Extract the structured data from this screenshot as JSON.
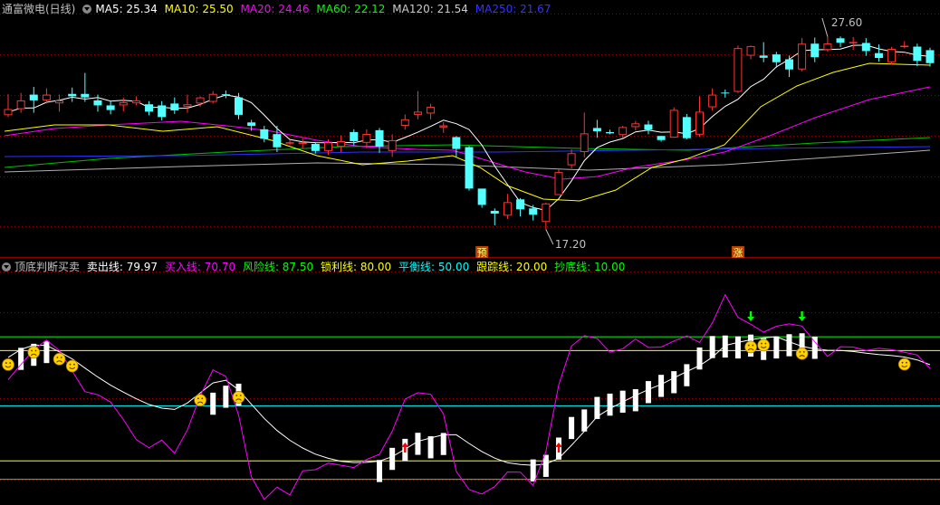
{
  "header": {
    "title": "通富微电(日线)",
    "ma": [
      {
        "label": "MA5: 25.34",
        "color": "#ffffff"
      },
      {
        "label": "MA10: 25.50",
        "color": "#ffff00"
      },
      {
        "label": "MA20: 24.46",
        "color": "#ff00ff"
      },
      {
        "label": "MA60: 22.12",
        "color": "#00ff00"
      },
      {
        "label": "MA120: 21.54",
        "color": "#cccccc"
      },
      {
        "label": "MA250: 21.67",
        "color": "#3333ff"
      }
    ]
  },
  "indicator_header": {
    "name": "顶底判断买卖",
    "lines": [
      {
        "label": "卖出线: 79.97",
        "color": "#ffffff"
      },
      {
        "label": "买入线: 70.70",
        "color": "#ff00ff"
      },
      {
        "label": "风险线: 87.50",
        "color": "#00ff00"
      },
      {
        "label": "锁利线: 80.00",
        "color": "#ffff00"
      },
      {
        "label": "平衡线: 50.00",
        "color": "#00ffff"
      },
      {
        "label": "跟踪线: 20.00",
        "color": "#ffff00"
      },
      {
        "label": "抄底线: 10.00",
        "color": "#00ff00"
      }
    ]
  },
  "colors": {
    "up": "#ff3333",
    "down": "#54ffff",
    "grid": "#880000",
    "text": "#c0c0c0"
  },
  "chart_data": [
    {
      "type": "candlestick",
      "ylim": [
        16.0,
        28.6
      ],
      "high_label": "27.60",
      "low_label": "17.20",
      "markers": [
        {
          "index": 37,
          "text": "预"
        },
        {
          "index": 57,
          "text": "涨"
        }
      ],
      "candles": [
        [
          23.36,
          23.69,
          23.26,
          24.49
        ],
        [
          23.69,
          24.16,
          23.49,
          24.56
        ],
        [
          24.47,
          24.16,
          23.49,
          24.89
        ],
        [
          24.16,
          24.47,
          23.99,
          24.81
        ],
        [
          24.0,
          24.16,
          23.55,
          24.47
        ],
        [
          24.51,
          24.38,
          24.08,
          24.85
        ],
        [
          24.51,
          24.32,
          24.08,
          25.64
        ],
        [
          24.16,
          23.89,
          23.55,
          24.47
        ],
        [
          23.89,
          23.64,
          23.41,
          24.12
        ],
        [
          23.89,
          24.06,
          23.57,
          24.31
        ],
        [
          24.0,
          24.16,
          23.89,
          24.38
        ],
        [
          23.95,
          23.55,
          23.36,
          24.12
        ],
        [
          23.89,
          23.26,
          23.08,
          24.12
        ],
        [
          23.99,
          23.62,
          23.43,
          24.32
        ],
        [
          23.81,
          23.95,
          23.49,
          24.47
        ],
        [
          23.99,
          24.32,
          23.81,
          24.38
        ],
        [
          24.08,
          24.51,
          23.99,
          24.66
        ],
        [
          24.49,
          24.47,
          24.28,
          24.69
        ],
        [
          24.32,
          23.38,
          23.14,
          24.56
        ],
        [
          22.97,
          22.79,
          22.52,
          23.11
        ],
        [
          22.6,
          22.09,
          21.9,
          22.79
        ],
        [
          22.34,
          21.63,
          21.37,
          22.79
        ],
        [
          21.86,
          21.9,
          21.74,
          22.03
        ],
        [
          21.85,
          21.89,
          21.54,
          22.12
        ],
        [
          21.81,
          21.43,
          21.29,
          21.9
        ],
        [
          21.43,
          21.89,
          21.22,
          22.06
        ],
        [
          21.66,
          21.96,
          21.37,
          22.28
        ],
        [
          22.45,
          21.96,
          21.73,
          22.6
        ],
        [
          21.87,
          22.35,
          21.59,
          22.6
        ],
        [
          22.55,
          21.66,
          21.33,
          22.67
        ],
        [
          21.43,
          22.01,
          21.11,
          22.33
        ],
        [
          22.79,
          23.14,
          22.58,
          23.4
        ],
        [
          23.38,
          23.55,
          23.14,
          24.66
        ],
        [
          23.45,
          23.81,
          23.14,
          23.98
        ],
        [
          22.7,
          22.81,
          22.41,
          22.99
        ],
        [
          22.18,
          21.54,
          21.07,
          22.23
        ],
        [
          21.64,
          19.4,
          19.29,
          21.7
        ],
        [
          19.4,
          18.52,
          18.37,
          18.58
        ],
        [
          18.2,
          18.05,
          17.42,
          18.33
        ],
        [
          17.94,
          18.67,
          17.76,
          19.11
        ],
        [
          18.82,
          18.28,
          17.9,
          18.89
        ],
        [
          18.33,
          17.99,
          17.68,
          18.52
        ],
        [
          17.6,
          18.6,
          17.2,
          18.65
        ],
        [
          19.05,
          20.29,
          19.05,
          20.42
        ],
        [
          20.66,
          21.31,
          20.49,
          21.52
        ],
        [
          21.37,
          22.38,
          21.09,
          23.5
        ],
        [
          22.67,
          22.49,
          22.14,
          23.11
        ],
        [
          22.45,
          22.38,
          22.33,
          22.58
        ],
        [
          22.29,
          22.72,
          22.14,
          22.79
        ],
        [
          22.72,
          22.92,
          22.54,
          23.05
        ],
        [
          22.86,
          22.58,
          22.33,
          23.06
        ],
        [
          22.24,
          22.02,
          21.93,
          22.24
        ],
        [
          22.15,
          23.65,
          22.14,
          23.78
        ],
        [
          23.26,
          22.12,
          22.06,
          23.42
        ],
        [
          22.31,
          23.55,
          22.2,
          24.38
        ],
        [
          23.79,
          24.47,
          23.6,
          24.81
        ],
        [
          24.58,
          24.56,
          24.31,
          24.75
        ],
        [
          24.62,
          26.98,
          24.56,
          27.12
        ],
        [
          26.57,
          27.09,
          26.38,
          27.12
        ],
        [
          26.58,
          26.46,
          26.22,
          27.3
        ],
        [
          26.64,
          26.22,
          25.92,
          26.78
        ],
        [
          26.38,
          25.83,
          25.42,
          26.58
        ],
        [
          25.83,
          27.22,
          25.73,
          27.52
        ],
        [
          27.22,
          26.49,
          26.22,
          27.55
        ],
        [
          26.88,
          27.23,
          26.78,
          27.6
        ],
        [
          27.51,
          27.27,
          27.04,
          27.61
        ],
        [
          27.26,
          27.31,
          26.89,
          27.58
        ],
        [
          27.26,
          26.82,
          26.56,
          27.52
        ],
        [
          26.71,
          26.45,
          26.25,
          27.18
        ],
        [
          26.22,
          26.94,
          26.1,
          27.05
        ],
        [
          27.05,
          27.11,
          26.97,
          27.35
        ],
        [
          27.06,
          26.29,
          26.01,
          27.22
        ],
        [
          26.87,
          26.17,
          25.99,
          27.0
        ]
      ],
      "ma5": [
        23.53,
        23.74,
        23.75,
        24.06,
        24.17,
        24.33,
        24.23,
        24.31,
        24.12,
        24.16,
        24.11,
        23.78,
        23.79,
        23.73,
        23.74,
        23.94,
        24.23,
        24.45,
        24.34,
        24.04,
        23.37,
        22.64,
        22.05,
        21.92,
        21.88,
        21.87,
        21.9,
        21.87,
        22.02,
        22.04,
        21.89,
        22.16,
        22.44,
        22.76,
        23.09,
        22.9,
        22.59,
        21.75,
        20.61,
        19.62,
        18.65,
        18.38,
        18.22,
        18.85,
        19.82,
        20.91,
        21.61,
        21.91,
        22.1,
        22.46,
        22.56,
        22.44,
        22.46,
        22.36,
        22.64,
        23.29,
        23.84,
        24.22,
        24.91,
        25.3,
        25.97,
        26.38,
        26.84,
        26.89,
        26.9,
        26.93,
        27.13,
        27.14,
        26.94,
        26.8,
        26.76,
        26.6,
        26.53
      ]
    },
    {
      "type": "line",
      "ylim": [
        -3,
        123
      ],
      "reference_lines": [
        {
          "name": "风险线",
          "value": 87.5,
          "color": "#00ff00"
        },
        {
          "name": "锁利线",
          "value": 80.0,
          "color": "#ffff00"
        },
        {
          "name": "平衡线",
          "value": 50.0,
          "color": "#00ffff"
        },
        {
          "name": "跟踪线",
          "value": 20.0,
          "color": "#ffff00"
        },
        {
          "name": "抄底线",
          "value": 10.0,
          "color": "#00ff00"
        }
      ],
      "series": [
        {
          "name": "卖出线",
          "color": "#ffffff",
          "values": [
            76.3,
            80.6,
            83.0,
            82.8,
            79.3,
            75.5,
            70.5,
            65.6,
            61.2,
            57.4,
            53.8,
            50.7,
            48.7,
            48.0,
            51.5,
            57.0,
            62.4,
            63.9,
            58.6,
            50.8,
            43.1,
            36.5,
            31.2,
            27.0,
            23.7,
            21.4,
            19.8,
            19.1,
            19.2,
            19.9,
            22.3,
            26.4,
            30.6,
            32.5,
            34.2,
            34.2,
            29.5,
            25.1,
            21.5,
            19.0,
            18.0,
            17.6,
            18.3,
            21.4,
            28.5,
            36.1,
            44.1,
            48.4,
            52.1,
            55.6,
            58.8,
            61.6,
            65.1,
            68.6,
            71.8,
            76.4,
            82.8,
            84.4,
            85.9,
            86.9,
            87.5,
            84.8,
            82.3,
            80.9,
            80.2,
            80.1,
            79.5,
            78.6,
            77.8,
            77.3,
            76.5,
            74.9,
            72.3
          ]
        },
        {
          "name": "买入线",
          "color": "#ff00ff",
          "values": [
            64.2,
            72.4,
            80.5,
            85.7,
            80.0,
            68.9,
            57.7,
            56.0,
            52.0,
            42.5,
            31.6,
            27.1,
            31.3,
            24.2,
            36.8,
            55.4,
            69.5,
            66.0,
            44.9,
            11.3,
            -1.0,
            5.7,
            1.5,
            14.6,
            15.2,
            18.8,
            17.6,
            16.4,
            20.8,
            23.6,
            36.2,
            53.6,
            57.1,
            56.2,
            45.5,
            14.3,
            4.4,
            2.0,
            6.0,
            14.0,
            13.9,
            6.7,
            25.0,
            61.4,
            82.5,
            88.1,
            86.6,
            79.1,
            81.0,
            86.3,
            81.7,
            81.9,
            85.2,
            88.0,
            84.4,
            95.0,
            110.4,
            98.1,
            94.3,
            90.0,
            93.2,
            94.5,
            93.3,
            84.7,
            76.9,
            82.1,
            81.9,
            80.1,
            81.2,
            80.5,
            79.1,
            77.6,
            70.4
          ]
        }
      ],
      "bars": [
        [
          1,
          81.5
        ],
        [
          2,
          83.7
        ],
        [
          3,
          85.2
        ],
        [
          16,
          57.1
        ],
        [
          17,
          60.9
        ],
        [
          18,
          62.0
        ],
        [
          29,
          20.5
        ],
        [
          30,
          27.1
        ],
        [
          31,
          32.0
        ],
        [
          32,
          35.3
        ],
        [
          33,
          33.4
        ],
        [
          34,
          35.2
        ],
        [
          41,
          20.8
        ],
        [
          42,
          23.3
        ],
        [
          43,
          32.7
        ],
        [
          44,
          43.9
        ],
        [
          45,
          48.0
        ],
        [
          46,
          54.8
        ],
        [
          47,
          56.6
        ],
        [
          48,
          58.2
        ],
        [
          49,
          59.0
        ],
        [
          50,
          63.4
        ],
        [
          51,
          66.8
        ],
        [
          52,
          68.8
        ],
        [
          53,
          72.6
        ],
        [
          54,
          81.7
        ],
        [
          55,
          87.9
        ],
        [
          56,
          88.2
        ],
        [
          57,
          87.7
        ],
        [
          58,
          88.7
        ],
        [
          59,
          86.9
        ],
        [
          60,
          87.7
        ],
        [
          61,
          88.9
        ],
        [
          62,
          89.4
        ],
        [
          63,
          87.5
        ]
      ],
      "icons": [
        {
          "index": 0,
          "type": "smile"
        },
        {
          "index": 2,
          "type": "frown"
        },
        {
          "index": 4,
          "type": "frown"
        },
        {
          "index": 5,
          "type": "smile"
        },
        {
          "index": 15,
          "type": "frown"
        },
        {
          "index": 18,
          "type": "frown"
        },
        {
          "index": 58,
          "type": "frown"
        },
        {
          "index": 59,
          "type": "smile"
        },
        {
          "index": 62,
          "type": "frown"
        },
        {
          "index": 70,
          "type": "smile"
        }
      ],
      "arrows": [
        {
          "index": 31,
          "dir": "up",
          "color": "#ff0000"
        },
        {
          "index": 43,
          "dir": "up",
          "color": "#ff0000"
        },
        {
          "index": 58,
          "dir": "down",
          "color": "#00ff00"
        },
        {
          "index": 62,
          "dir": "down",
          "color": "#00ff00"
        }
      ]
    }
  ]
}
